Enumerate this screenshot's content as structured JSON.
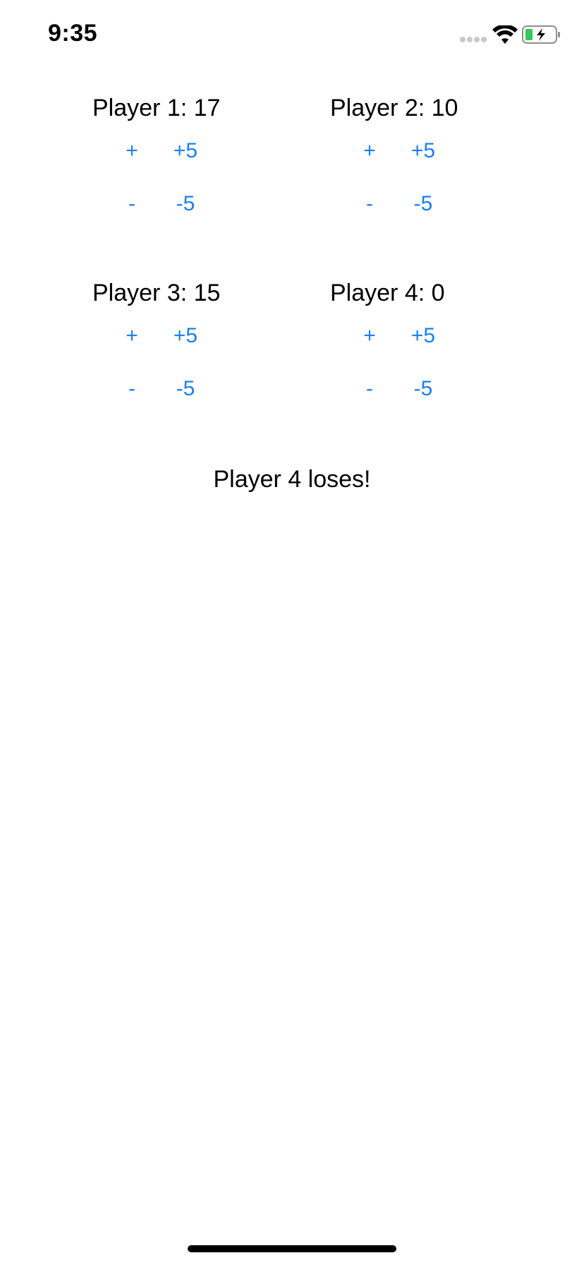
{
  "status_bar": {
    "time": "9:35",
    "signal_icon": "signal-dots-icon",
    "wifi_icon": "wifi-icon",
    "battery_icon": "battery-charging-icon",
    "battery_color": "#34c759"
  },
  "accent_color": "#1a7ff0",
  "players": [
    {
      "label": "Player 1: 17",
      "plus": "+",
      "plus5": "+5",
      "minus": "-",
      "minus5": "-5"
    },
    {
      "label": "Player 2: 10",
      "plus": "+",
      "plus5": "+5",
      "minus": "-",
      "minus5": "-5"
    },
    {
      "label": "Player 3: 15",
      "plus": "+",
      "plus5": "+5",
      "minus": "-",
      "minus5": "-5"
    },
    {
      "label": "Player 4: 0",
      "plus": "+",
      "plus5": "+5",
      "minus": "-",
      "minus5": "-5"
    }
  ],
  "result_message": "Player 4 loses!"
}
